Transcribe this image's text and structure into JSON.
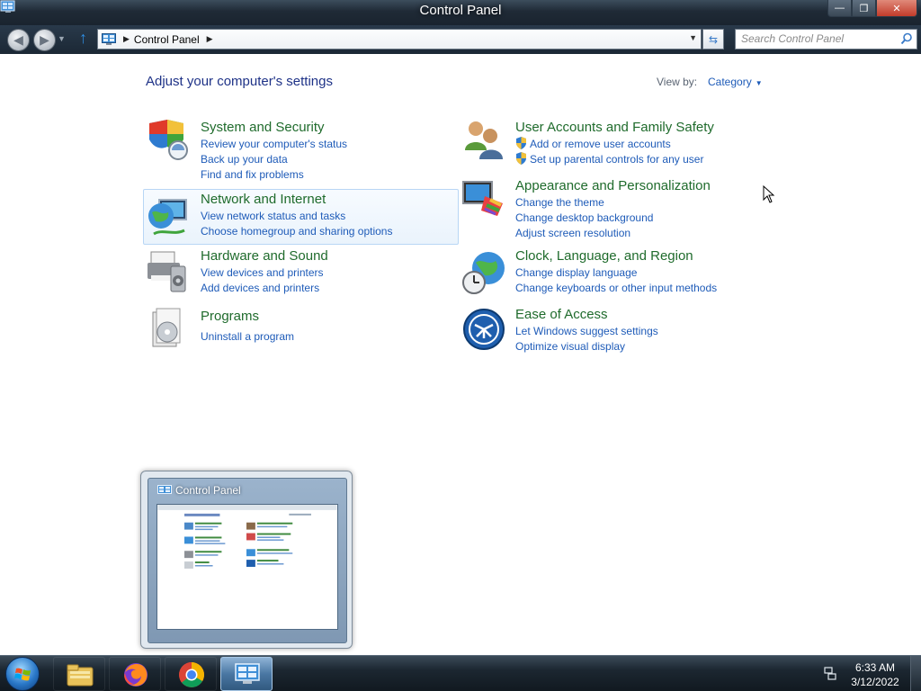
{
  "window": {
    "title": "Control Panel",
    "minimize_label": "—",
    "maximize_label": "❐",
    "close_label": "✕"
  },
  "address": {
    "breadcrumb": "Control Panel",
    "search_placeholder": "Search Control Panel"
  },
  "main": {
    "heading": "Adjust your computer's settings",
    "view_by_label": "View by:",
    "view_by_value": "Category",
    "categories": [
      {
        "title": "System and Security",
        "icon": "shield-icon",
        "links": [
          "Review your computer's status",
          "Back up your data",
          "Find and fix problems"
        ]
      },
      {
        "title": "Network and Internet",
        "icon": "network-globe-icon",
        "links": [
          "View network status and tasks",
          "Choose homegroup and sharing options"
        ]
      },
      {
        "title": "Hardware and Sound",
        "icon": "printer-speaker-icon",
        "links": [
          "View devices and printers",
          "Add devices and printers"
        ]
      },
      {
        "title": "Programs",
        "icon": "programs-icon",
        "links": [
          "Uninstall a program"
        ]
      },
      {
        "title": "User Accounts and Family Safety",
        "icon": "users-icon",
        "links": [
          "Add or remove user accounts",
          "Set up parental controls for any user"
        ]
      },
      {
        "title": "Appearance and Personalization",
        "icon": "monitor-palette-icon",
        "links": [
          "Change the theme",
          "Change desktop background",
          "Adjust screen resolution"
        ]
      },
      {
        "title": "Clock, Language, and Region",
        "icon": "clock-globe-icon",
        "links": [
          "Change display language",
          "Change keyboards or other input methods"
        ]
      },
      {
        "title": "Ease of Access",
        "icon": "ease-of-access-icon",
        "links": [
          "Let Windows suggest settings",
          "Optimize visual display"
        ]
      }
    ]
  },
  "thumbnail": {
    "title": "Control Panel"
  },
  "taskbar": {
    "items": [
      "file-explorer-icon",
      "firefox-icon",
      "chrome-icon",
      "control-panel-icon"
    ],
    "active_item": "Control Panel",
    "time": "6:33 AM",
    "date": "3/12/2022"
  },
  "colors": {
    "category_title": "#1f6b2c",
    "link": "#1e5bb8",
    "heading": "#1e3287",
    "hover_border": "#b8d6f5"
  }
}
